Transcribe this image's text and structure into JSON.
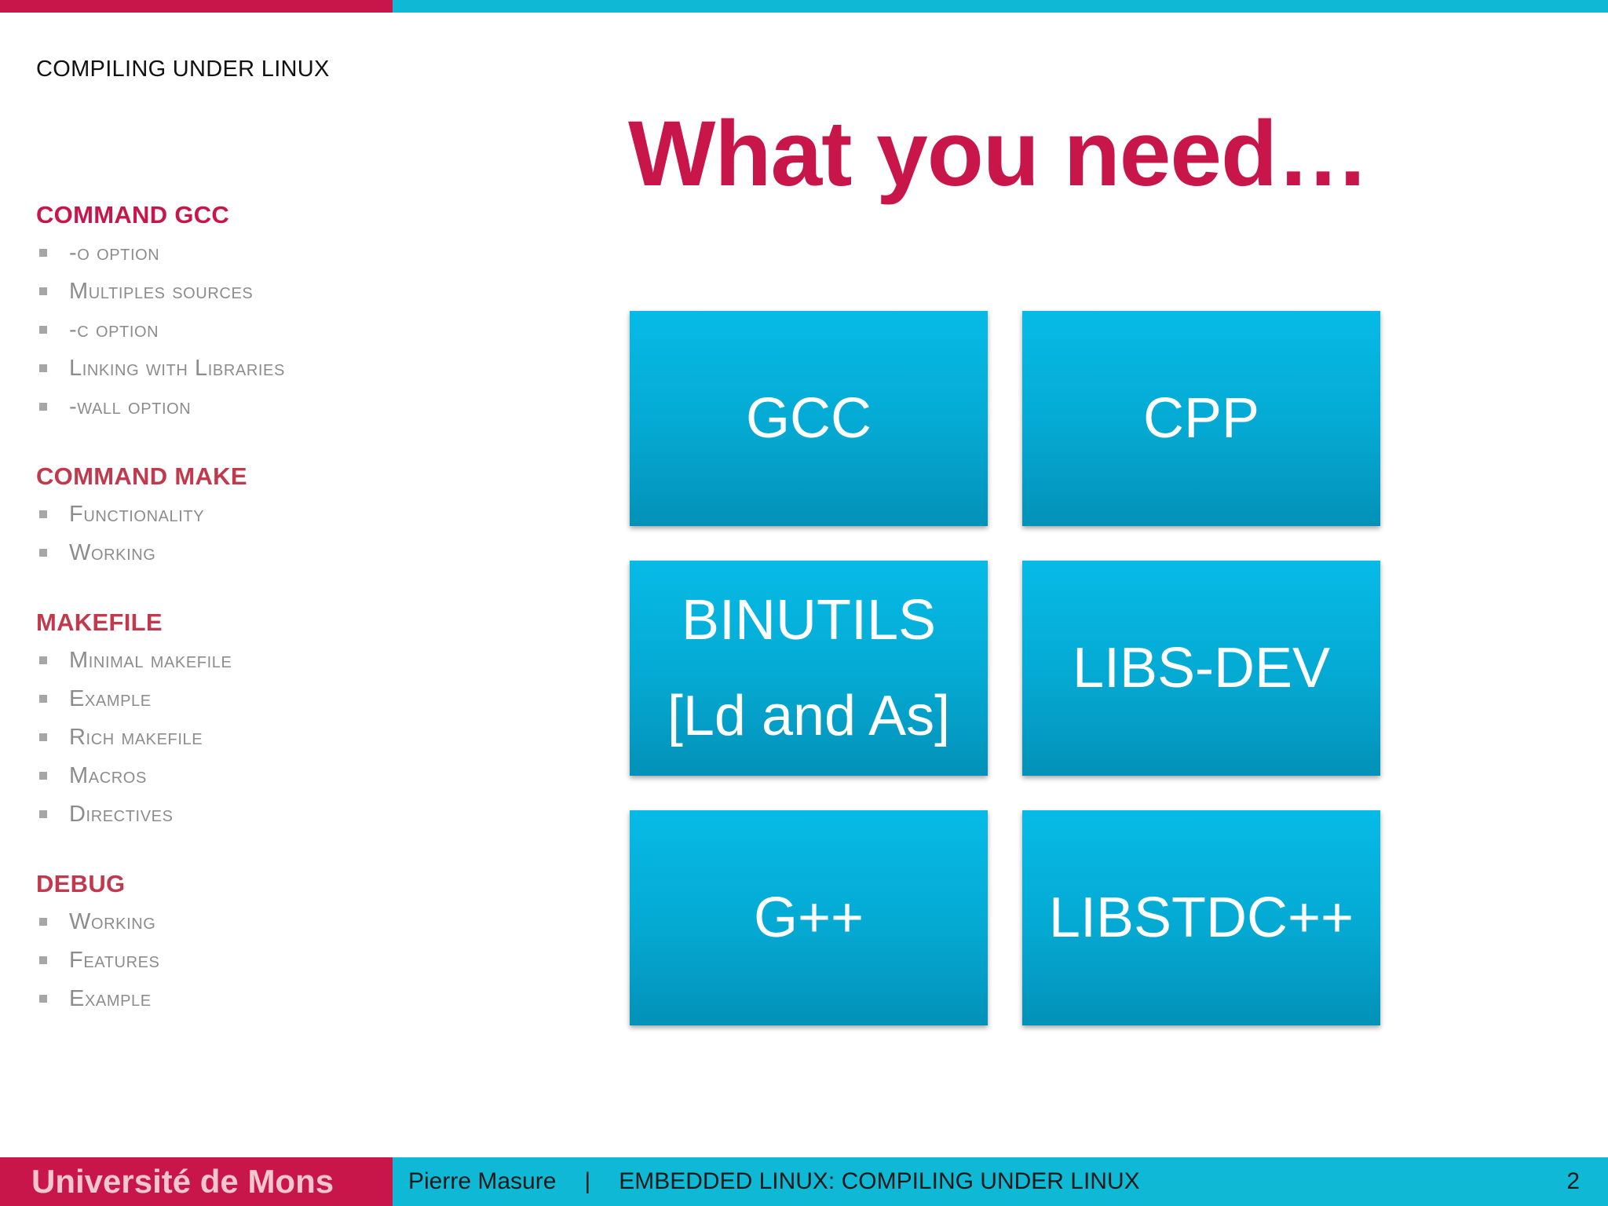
{
  "header": {
    "section_title": "COMPILING UNDER LINUX"
  },
  "sidebar": {
    "groups": [
      {
        "title": "COMMAND GCC",
        "items": [
          "-o option",
          "Multiples sources",
          "-c option",
          "Linking with Libraries",
          "-wall option"
        ]
      },
      {
        "title": "COMMAND MAKE",
        "items": [
          "Functionality",
          "Working"
        ]
      },
      {
        "title": "MAKEFILE",
        "items": [
          "Minimal makefile",
          "Example",
          "Rich makefile",
          "Macros",
          "Directives"
        ]
      },
      {
        "title": "DEBUG",
        "items": [
          "Working",
          "Features",
          "Example"
        ]
      }
    ]
  },
  "main": {
    "heading": "What you need…",
    "tiles": [
      {
        "lines": [
          "GCC"
        ]
      },
      {
        "lines": [
          "CPP"
        ]
      },
      {
        "lines": [
          "BINUTILS",
          "[Ld and As]"
        ]
      },
      {
        "lines": [
          "LIBS-DEV"
        ]
      },
      {
        "lines": [
          "G++"
        ]
      },
      {
        "lines": [
          "LIBSTDC++"
        ]
      }
    ]
  },
  "footer": {
    "university": "Université de Mons",
    "author": "Pierre Masure",
    "separator": "|",
    "course": "EMBEDDED LINUX: COMPILING UNDER LINUX",
    "page": "2"
  },
  "colors": {
    "accent_red": "#c8164a",
    "accent_cyan": "#0fb8d4",
    "tile_blue": "#04a9d2"
  }
}
